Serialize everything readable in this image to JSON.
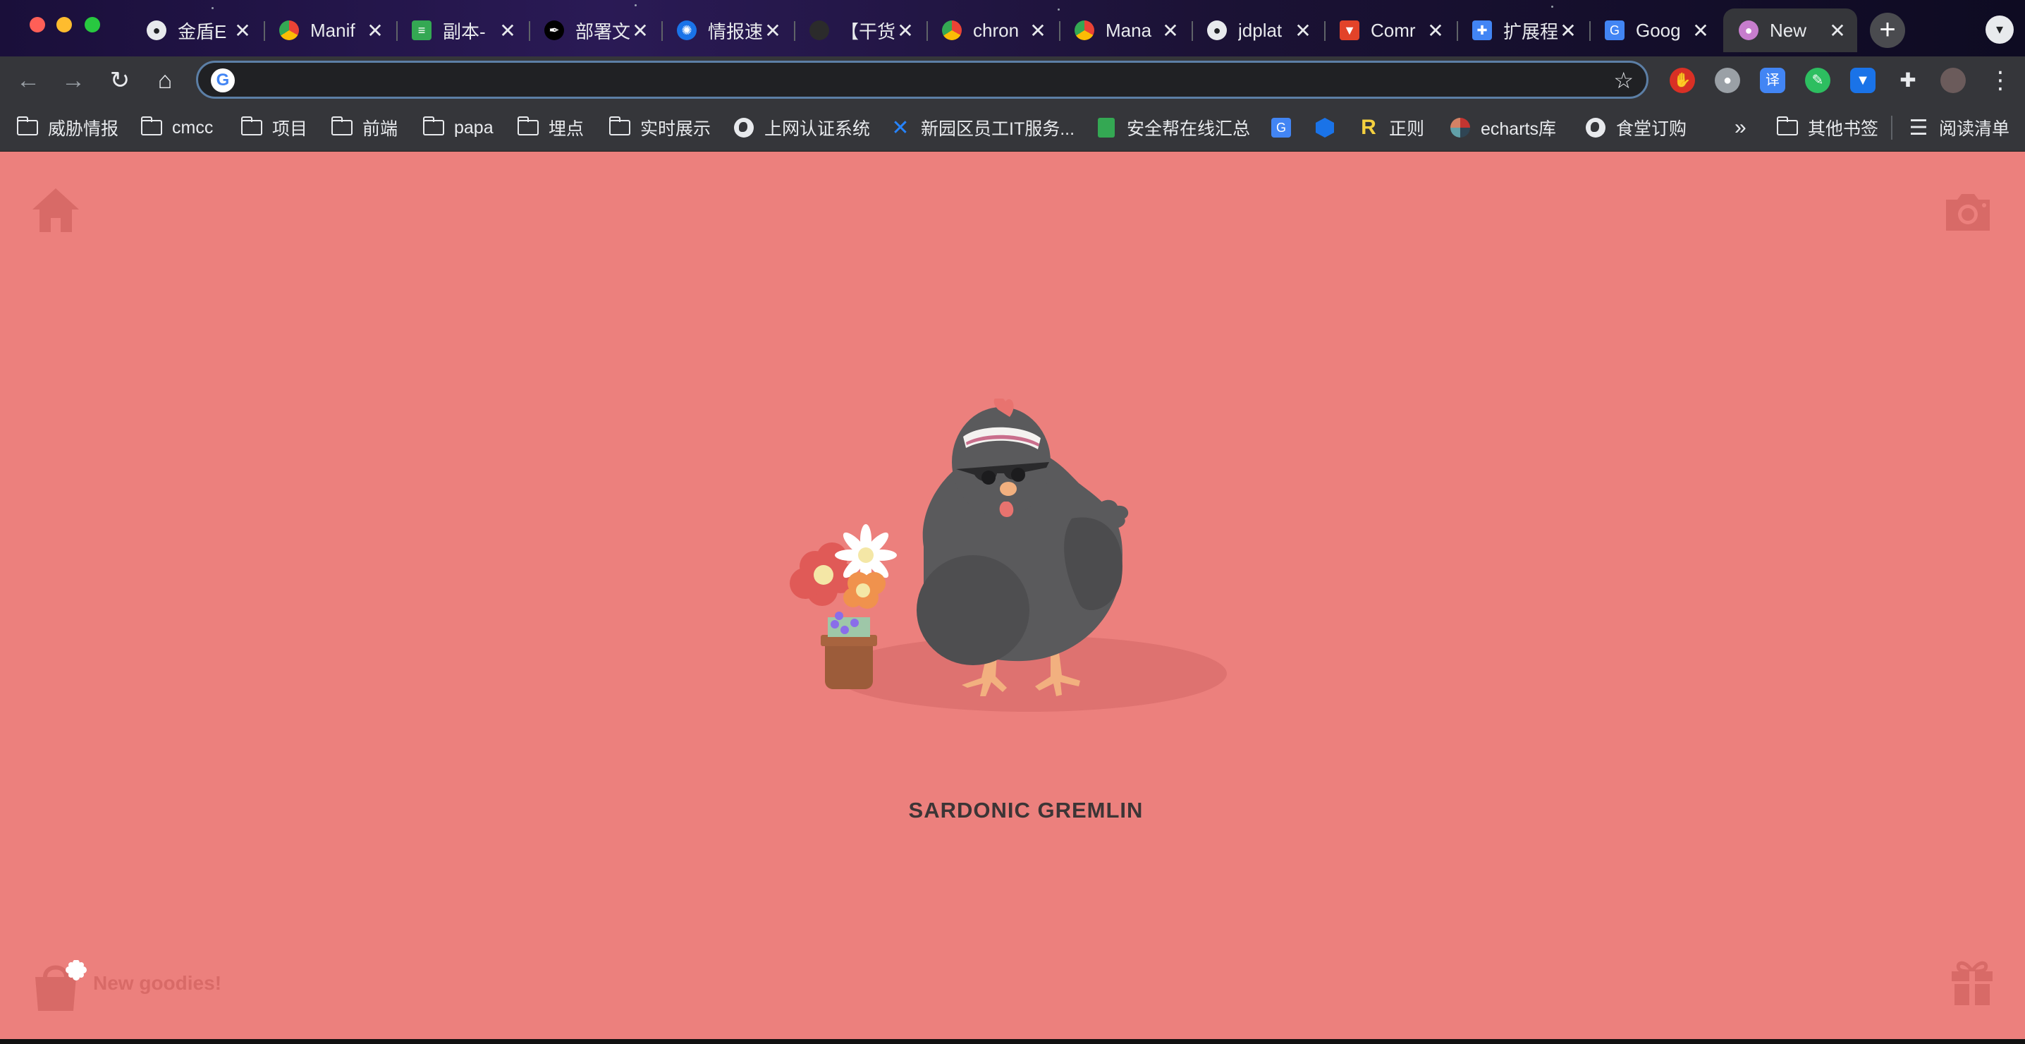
{
  "tabs": [
    {
      "title": "金盾E",
      "favicon": "globe-icon",
      "active": false
    },
    {
      "title": "Manif",
      "favicon": "chrome-icon",
      "active": false
    },
    {
      "title": "副本-",
      "favicon": "sheets-icon",
      "active": false
    },
    {
      "title": "部署文",
      "favicon": "feather-icon",
      "active": false
    },
    {
      "title": "情报速",
      "favicon": "swirl-icon",
      "active": false
    },
    {
      "title": "【干货",
      "favicon": "github-icon",
      "active": false
    },
    {
      "title": "chron",
      "favicon": "chrome-icon",
      "active": false
    },
    {
      "title": "Mana",
      "favicon": "chrome-icon",
      "active": false
    },
    {
      "title": "jdplat",
      "favicon": "globe-icon",
      "active": false
    },
    {
      "title": "Comr",
      "favicon": "gitlab-icon",
      "active": false
    },
    {
      "title": "扩展程",
      "favicon": "puzzle-icon",
      "active": false
    },
    {
      "title": "Goog",
      "favicon": "translate-icon",
      "active": false
    },
    {
      "title": "New",
      "favicon": "pet-icon",
      "active": true
    }
  ],
  "omnibox": {
    "value": "",
    "placeholder": ""
  },
  "bookmarks": [
    {
      "label": "威胁情报",
      "icon": "folder-icon"
    },
    {
      "label": "cmcc",
      "icon": "folder-icon"
    },
    {
      "label": "项目",
      "icon": "folder-icon"
    },
    {
      "label": "前端",
      "icon": "folder-icon"
    },
    {
      "label": "papa",
      "icon": "folder-icon"
    },
    {
      "label": "埋点",
      "icon": "folder-icon"
    },
    {
      "label": "实时展示",
      "icon": "folder-icon"
    },
    {
      "label": "上网认证系统",
      "icon": "globe-icon"
    },
    {
      "label": "新园区员工IT服务...",
      "icon": "confluence-icon"
    },
    {
      "label": "安全帮在线汇总",
      "icon": "sheets-icon"
    },
    {
      "label": "",
      "icon": "translate-icon"
    },
    {
      "label": "",
      "icon": "cube-icon"
    },
    {
      "label": "正则",
      "icon": "r-icon"
    },
    {
      "label": "echarts库",
      "icon": "echarts-icon"
    },
    {
      "label": "食堂订购",
      "icon": "globe-icon"
    }
  ],
  "bookmarks_overflow": "»",
  "other_bookmarks": "其他书签",
  "reading_list": "阅读清单",
  "pet": {
    "name": "SARDONIC GREMLIN"
  },
  "goodies": {
    "label": "New goodies!"
  },
  "colors": {
    "page_bg": "#ec807d",
    "accent": "#d86a67",
    "chrome_dark": "#35363a"
  }
}
